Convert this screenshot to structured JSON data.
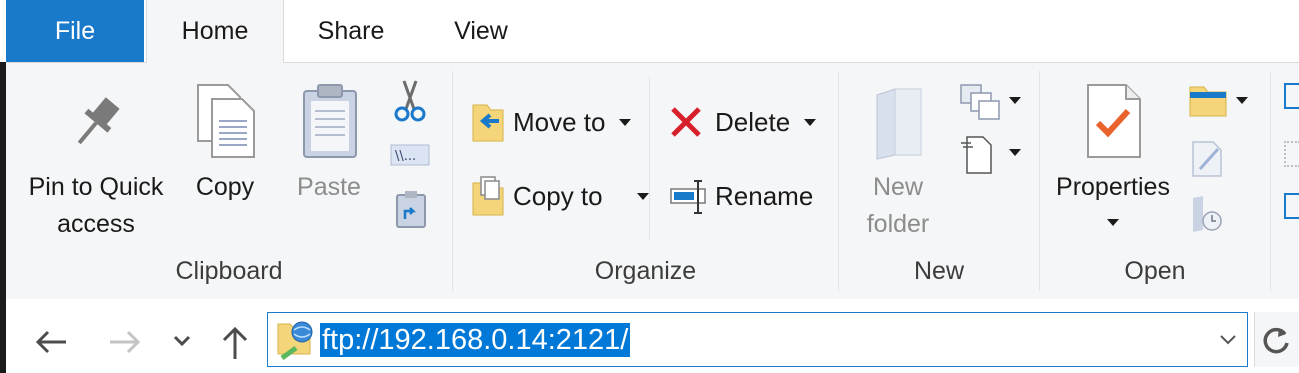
{
  "tabs": [
    {
      "label": "File"
    },
    {
      "label": "Home"
    },
    {
      "label": "Share"
    },
    {
      "label": "View"
    }
  ],
  "clipboard": {
    "group_label": "Clipboard",
    "pin_line1": "Pin to Quick",
    "pin_line2": "access",
    "copy_label": "Copy",
    "paste_label": "Paste"
  },
  "organize": {
    "group_label": "Organize",
    "move_to": "Move to",
    "copy_to": "Copy to",
    "delete": "Delete",
    "rename": "Rename"
  },
  "new_group": {
    "group_label": "New",
    "new_folder_line1": "New",
    "new_folder_line2": "folder"
  },
  "open_group": {
    "group_label": "Open",
    "properties": "Properties"
  },
  "address": {
    "value": "ftp://192.168.0.14:2121/"
  },
  "colors": {
    "accent": "#1979ca",
    "selection": "#0078d7",
    "delete_red": "#d8202c",
    "check_orange": "#e8642c",
    "folder_yellow": "#f4d57a"
  },
  "icons": {
    "pin": "pin-icon",
    "copy": "copy-icon",
    "paste": "paste-icon",
    "cut": "scissors-icon",
    "copy_path": "copy-path-icon",
    "paste_shortcut": "paste-shortcut-icon",
    "move_to": "move-to-icon",
    "copy_to": "copy-to-icon",
    "delete": "delete-icon",
    "rename": "rename-icon",
    "new_folder": "new-folder-icon",
    "new_item": "new-item-icon",
    "easy_access": "easy-access-icon",
    "properties": "properties-icon",
    "open": "open-icon",
    "edit": "edit-icon",
    "history": "history-icon",
    "back": "back-arrow-icon",
    "forward": "forward-arrow-icon",
    "recent": "chevron-down-icon",
    "up": "up-arrow-icon",
    "ftp": "ftp-location-icon",
    "refresh": "refresh-icon"
  }
}
